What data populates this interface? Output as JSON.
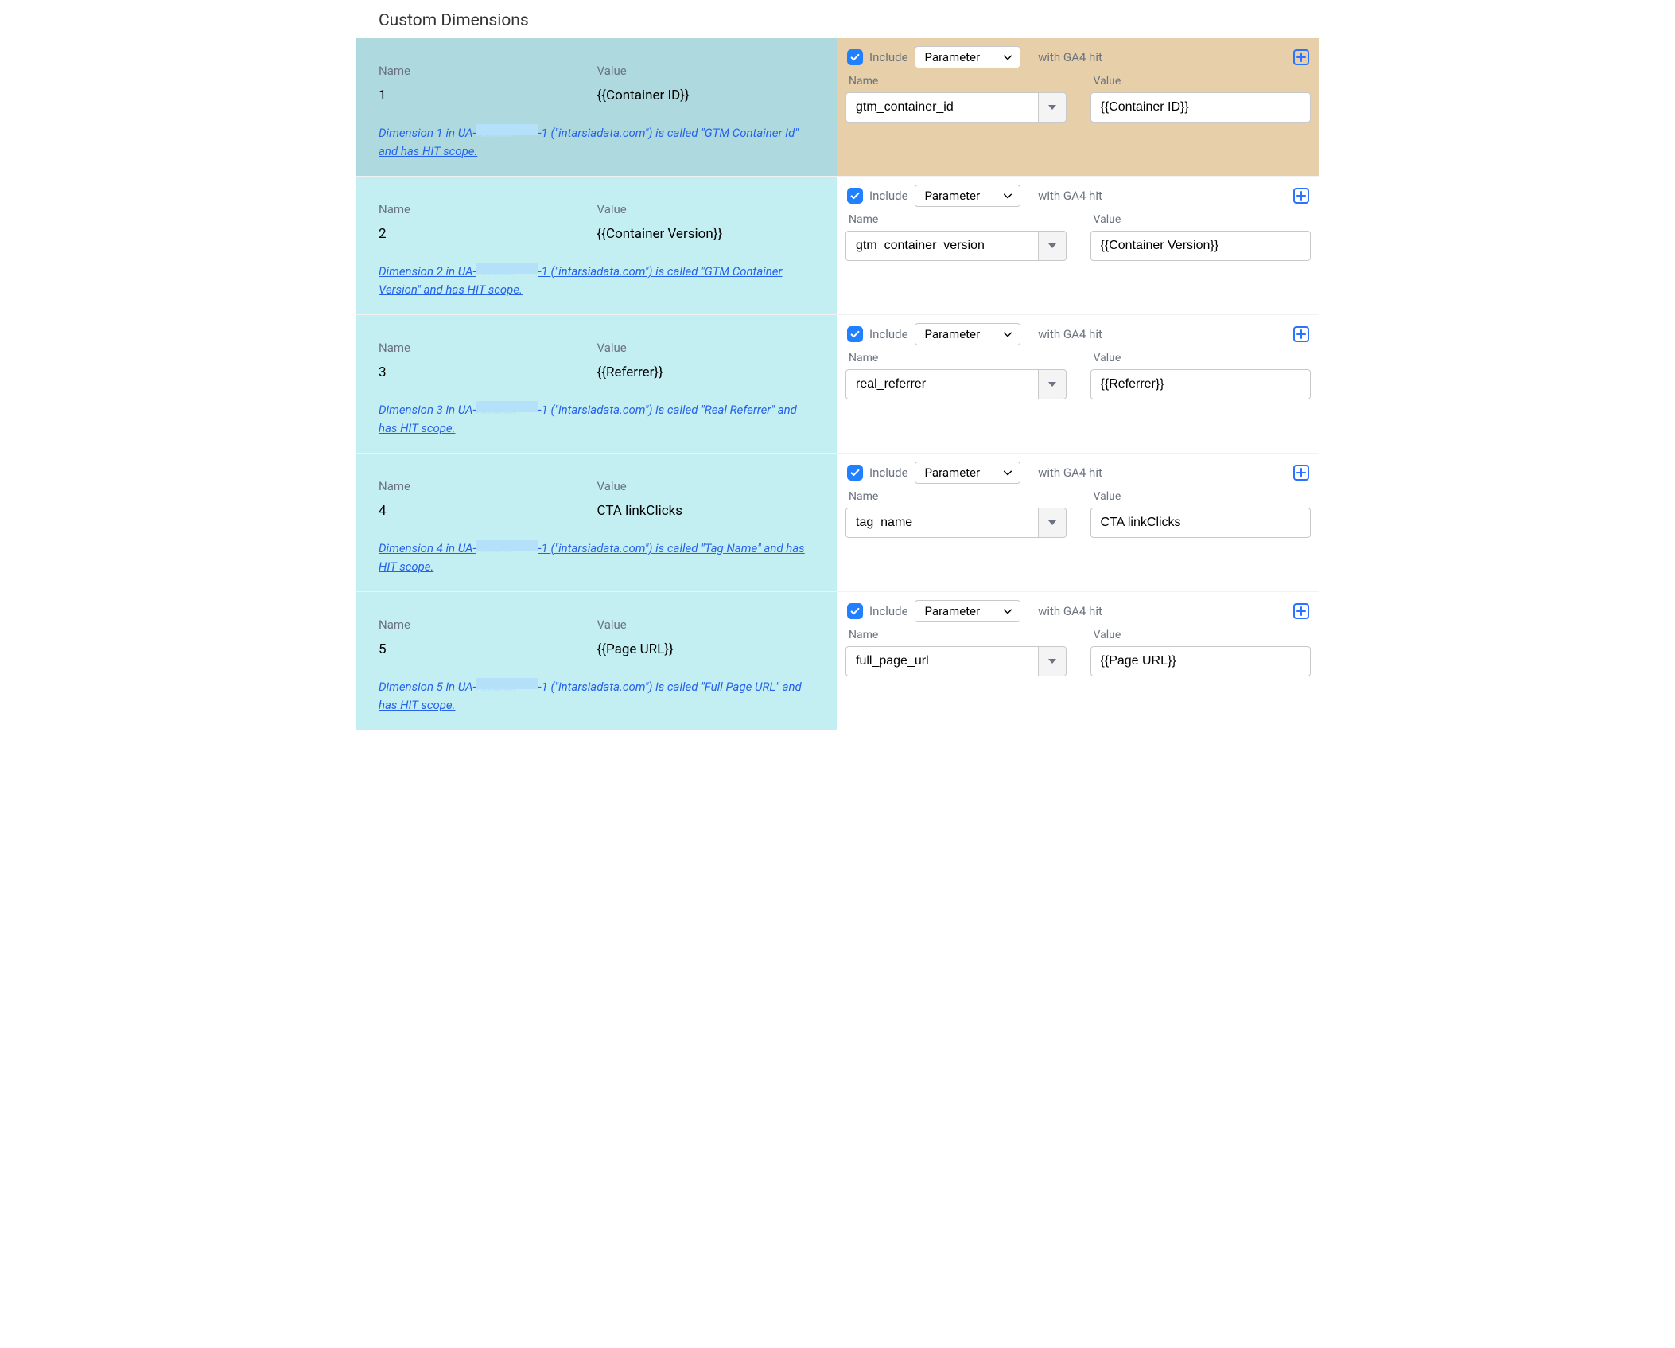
{
  "section_title": "Custom Dimensions",
  "labels": {
    "name": "Name",
    "value": "Value",
    "include": "Include",
    "with_hit": "with GA4 hit"
  },
  "select_default": "Parameter",
  "rows": [
    {
      "highlighted": true,
      "left": {
        "name": "1",
        "value": "{{Container ID}}",
        "note_pre": "Dimension 1 in UA-",
        "note_post": "-1 (\"intarsiadata.com\") is called \"GTM Container Id\" and has HIT scope."
      },
      "right": {
        "name_value": "gtm_container_id",
        "value_value": "{{Container ID}}"
      }
    },
    {
      "highlighted": false,
      "left": {
        "name": "2",
        "value": "{{Container Version}}",
        "note_pre": "Dimension 2 in UA-",
        "note_post": "-1 (\"intarsiadata.com\") is called \"GTM Container Version\" and has HIT scope."
      },
      "right": {
        "name_value": "gtm_container_version",
        "value_value": "{{Container Version}}"
      }
    },
    {
      "highlighted": false,
      "left": {
        "name": "3",
        "value": "{{Referrer}}",
        "note_pre": "Dimension 3 in UA-",
        "note_post": "-1 (\"intarsiadata.com\") is called \"Real Referrer\" and has HIT scope."
      },
      "right": {
        "name_value": "real_referrer",
        "value_value": "{{Referrer}}"
      }
    },
    {
      "highlighted": false,
      "left": {
        "name": "4",
        "value": "CTA linkClicks",
        "note_pre": "Dimension 4 in UA-",
        "note_post": "-1 (\"intarsiadata.com\") is called \"Tag Name\" and has HIT scope."
      },
      "right": {
        "name_value": "tag_name",
        "value_value": "CTA linkClicks"
      }
    },
    {
      "highlighted": false,
      "left": {
        "name": "5",
        "value": "{{Page URL}}",
        "note_pre": "Dimension 5 in UA-",
        "note_post": "-1 (\"intarsiadata.com\") is called \"Full Page URL\" and has HIT scope."
      },
      "right": {
        "name_value": "full_page_url",
        "value_value": "{{Page URL}}"
      }
    }
  ]
}
